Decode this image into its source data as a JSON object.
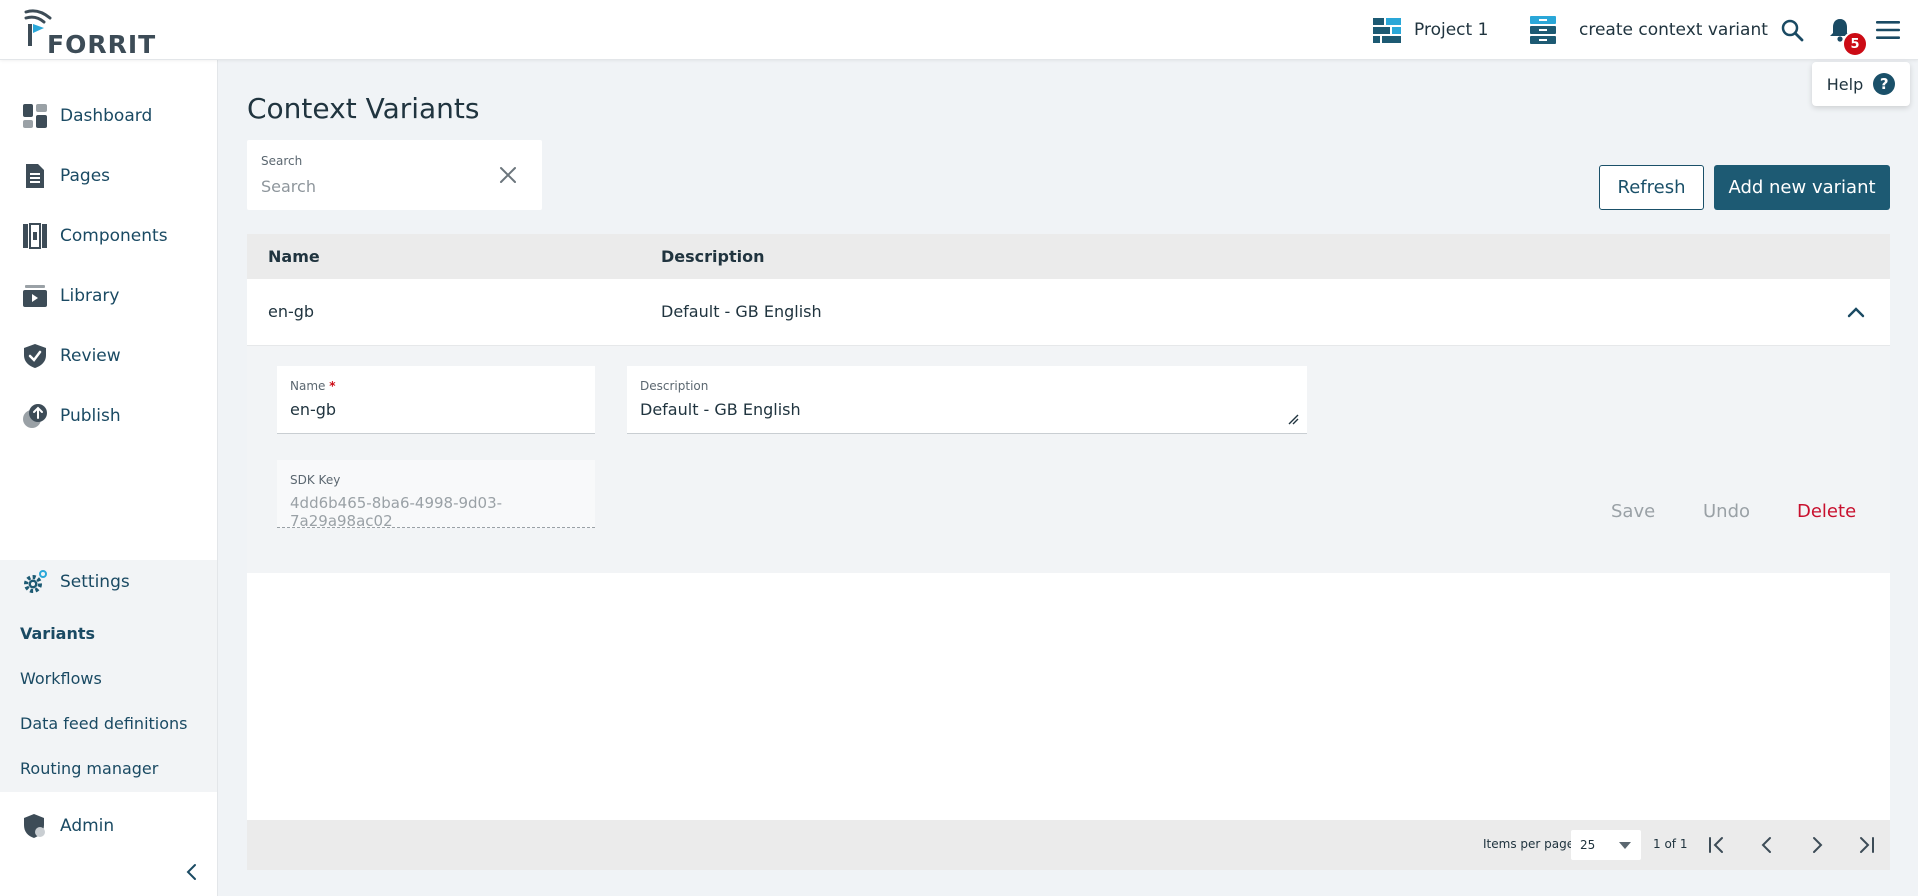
{
  "brand": {
    "name": "FORRIT"
  },
  "header": {
    "project_label": "Project 1",
    "variant_label": "create context variant",
    "notification_count": "5",
    "help_label": "Help",
    "help_symbol": "?"
  },
  "sidebar": {
    "items": [
      {
        "label": "Dashboard",
        "icon": "dashboard-icon"
      },
      {
        "label": "Pages",
        "icon": "pages-icon"
      },
      {
        "label": "Components",
        "icon": "components-icon"
      },
      {
        "label": "Library",
        "icon": "library-icon"
      },
      {
        "label": "Review",
        "icon": "review-icon"
      },
      {
        "label": "Publish",
        "icon": "publish-icon"
      }
    ],
    "settings": {
      "label": "Settings",
      "sub_items": [
        "Variants",
        "Workflows",
        "Data feed definitions",
        "Routing manager"
      ],
      "active": "Variants"
    },
    "admin_label": "Admin"
  },
  "main": {
    "title": "Context Variants",
    "search": {
      "label": "Search",
      "placeholder": "Search",
      "value": ""
    },
    "refresh_label": "Refresh",
    "add_label": "Add new variant"
  },
  "table": {
    "columns": [
      "Name",
      "Description"
    ],
    "rows": [
      {
        "name": "en-gb",
        "description": "Default - GB English",
        "expanded": true
      }
    ],
    "detail": {
      "name_label": "Name",
      "required_mark": "*",
      "name_value": "en-gb",
      "description_label": "Description",
      "description_value": "Default - GB English",
      "sdk_label": "SDK Key",
      "sdk_value": "4dd6b465-8ba6-4998-9d03-7a29a98ac02",
      "save_label": "Save",
      "undo_label": "Undo",
      "delete_label": "Delete"
    },
    "footer": {
      "items_per_page_label": "Items per page",
      "items_per_page_value": "25",
      "page_info": "1 of 1"
    }
  },
  "colors": {
    "primary": "#1d5a73",
    "accent_light": "#2aa7d8",
    "danger": "#c8102e",
    "badge": "#cc0b15",
    "background": "#f0f3f6"
  }
}
